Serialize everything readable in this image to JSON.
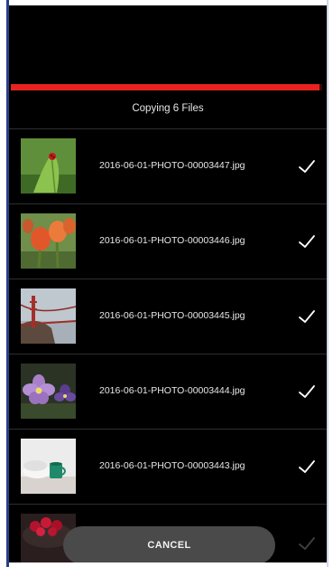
{
  "copy": {
    "status_text": "Copying 6 Files",
    "progress_fraction": 0.99,
    "accent_color": "#e8231f"
  },
  "files": [
    {
      "name": "2016-06-01-PHOTO-00003447.jpg",
      "thumbnail": "ladybug-on-leaf",
      "status": "copied",
      "status_icon": "checkmark-icon"
    },
    {
      "name": "2016-06-01-PHOTO-00003446.jpg",
      "thumbnail": "orange-tulips",
      "status": "copied",
      "status_icon": "checkmark-icon"
    },
    {
      "name": "2016-06-01-PHOTO-00003445.jpg",
      "thumbnail": "bridge-in-fog",
      "status": "copied",
      "status_icon": "checkmark-icon"
    },
    {
      "name": "2016-06-01-PHOTO-00003444.jpg",
      "thumbnail": "purple-flowers",
      "status": "copied",
      "status_icon": "checkmark-icon"
    },
    {
      "name": "2016-06-01-PHOTO-00003443.jpg",
      "thumbnail": "green-mug-on-table",
      "status": "copied",
      "status_icon": "checkmark-icon"
    },
    {
      "name": "",
      "thumbnail": "raspberries-bowl",
      "status": "in-progress",
      "status_icon": "checkmark-icon"
    }
  ],
  "actions": {
    "cancel_label": "CANCEL"
  }
}
